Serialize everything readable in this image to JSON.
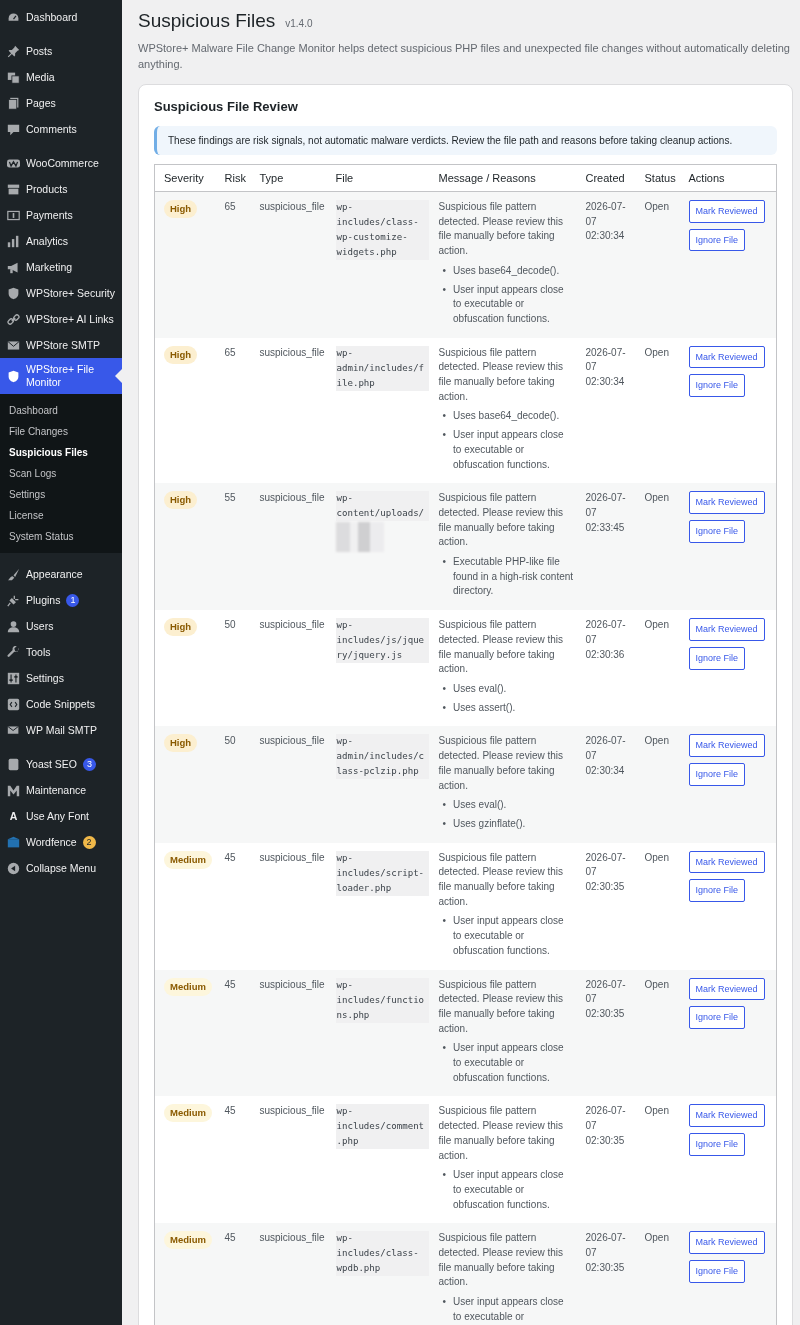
{
  "sidebar": {
    "groups": [
      {
        "items": [
          {
            "label": "Dashboard",
            "selected": false
          }
        ]
      },
      {
        "items": [
          {
            "label": "Posts",
            "selected": false
          },
          {
            "label": "Media",
            "selected": false
          },
          {
            "label": "Pages",
            "selected": false
          },
          {
            "label": "Comments",
            "selected": false
          }
        ]
      },
      {
        "items": [
          {
            "label": "WooCommerce",
            "selected": false
          },
          {
            "label": "Products",
            "selected": false
          },
          {
            "label": "Payments",
            "selected": false
          },
          {
            "label": "Analytics",
            "selected": false
          },
          {
            "label": "Marketing",
            "selected": false
          },
          {
            "label": "WPStore+ Security",
            "selected": false
          },
          {
            "label": "WPStore+ AI Links",
            "selected": false
          },
          {
            "label": "WPStore SMTP",
            "selected": false
          },
          {
            "label": "WPStore+ File Monitor",
            "selected": true,
            "submenu": [
              {
                "label": "Dashboard",
                "selected": false
              },
              {
                "label": "File Changes",
                "selected": false
              },
              {
                "label": "Suspicious Files",
                "selected": true
              },
              {
                "label": "Scan Logs",
                "selected": false
              },
              {
                "label": "Settings",
                "selected": false
              },
              {
                "label": "License",
                "selected": false
              },
              {
                "label": "System Status",
                "selected": false
              }
            ]
          }
        ]
      },
      {
        "items": [
          {
            "label": "Appearance",
            "selected": false
          },
          {
            "label": "Plugins",
            "selected": false,
            "badge": {
              "text": "1",
              "color": "#3858e9"
            }
          },
          {
            "label": "Users",
            "selected": false
          },
          {
            "label": "Tools",
            "selected": false
          },
          {
            "label": "Settings",
            "selected": false
          },
          {
            "label": "Code Snippets",
            "selected": false
          },
          {
            "label": "WP Mail SMTP",
            "selected": false
          }
        ]
      },
      {
        "items": [
          {
            "label": "Yoast SEO",
            "selected": false,
            "badge": {
              "text": "3",
              "color": "#3858e9"
            }
          },
          {
            "label": "Maintenance",
            "selected": false
          },
          {
            "label": "Use Any Font",
            "selected": false,
            "icon_glyph": "A"
          },
          {
            "label": "Wordfence",
            "selected": false,
            "badge": {
              "text": "2",
              "color": "#f0b849"
            }
          },
          {
            "label": "Collapse Menu",
            "selected": false
          }
        ]
      }
    ]
  },
  "page": {
    "title": "Suspicious Files",
    "version": "v1.4.0",
    "description": "WPStore+ Malware File Change Monitor helps detect suspicious PHP files and unexpected file changes without automatically deleting anything."
  },
  "card": {
    "title": "Suspicious File Review",
    "notice": "These findings are risk signals, not automatic malware verdicts. Review the file path and reasons before taking cleanup actions."
  },
  "table": {
    "columns": [
      "Severity",
      "Risk",
      "Type",
      "File",
      "Message / Reasons",
      "Created",
      "Status",
      "Actions"
    ],
    "rows": [
      {
        "severity": {
          "label": "High",
          "color": "#fcefd0"
        },
        "risk": "65",
        "type": "suspicious_file",
        "file": "wp-includes/class-wp-customize-widgets.php",
        "message": "Suspicious file pattern detected. Please review this file manually before taking action.",
        "reasons": [
          {
            "marker": "•",
            "text": "Uses base64_decode()."
          },
          {
            "marker": "•",
            "text": "User input appears close to executable or obfuscation functions."
          }
        ],
        "created": "2026-07-07 02:30:34",
        "status": "Open",
        "actions": [
          "Mark Reviewed",
          "Ignore File"
        ]
      },
      {
        "severity": {
          "label": "High",
          "color": "#fcefd0"
        },
        "risk": "65",
        "type": "suspicious_file",
        "file": "wp-admin/includes/file.php",
        "message": "Suspicious file pattern detected. Please review this file manually before taking action.",
        "reasons": [
          {
            "marker": "•",
            "text": "Uses base64_decode()."
          },
          {
            "marker": "•",
            "text": "User input appears close to executable or obfuscation functions."
          }
        ],
        "created": "2026-07-07 02:30:34",
        "status": "Open",
        "actions": [
          "Mark Reviewed",
          "Ignore File"
        ]
      },
      {
        "severity": {
          "label": "High",
          "color": "#fcefd0"
        },
        "risk": "55",
        "type": "suspicious_file",
        "file": "wp-content/uploads/",
        "file_redacted": true,
        "message": "Suspicious file pattern detected. Please review this file manually before taking action.",
        "reasons": [
          {
            "marker": "•",
            "text": "Executable PHP-like file found in a high-risk content directory."
          }
        ],
        "created": "2026-07-07 02:33:45",
        "status": "Open",
        "actions": [
          "Mark Reviewed",
          "Ignore File"
        ]
      },
      {
        "severity": {
          "label": "High",
          "color": "#fcefd0"
        },
        "risk": "50",
        "type": "suspicious_file",
        "file": "wp-includes/js/jquery/jquery.js",
        "message": "Suspicious file pattern detected. Please review this file manually before taking action.",
        "reasons": [
          {
            "marker": "•",
            "text": "Uses eval()."
          },
          {
            "marker": "•",
            "text": "Uses assert()."
          }
        ],
        "created": "2026-07-07 02:30:36",
        "status": "Open",
        "actions": [
          "Mark Reviewed",
          "Ignore File"
        ]
      },
      {
        "severity": {
          "label": "High",
          "color": "#fcefd0"
        },
        "risk": "50",
        "type": "suspicious_file",
        "file": "wp-admin/includes/class-pclzip.php",
        "message": "Suspicious file pattern detected. Please review this file manually before taking action.",
        "reasons": [
          {
            "marker": "•",
            "text": "Uses eval()."
          },
          {
            "marker": "•",
            "text": "Uses gzinflate()."
          }
        ],
        "created": "2026-07-07 02:30:34",
        "status": "Open",
        "actions": [
          "Mark Reviewed",
          "Ignore File"
        ]
      },
      {
        "severity": {
          "label": "Medium",
          "color": "#fdf6dc"
        },
        "risk": "45",
        "type": "suspicious_file",
        "file": "wp-includes/script-loader.php",
        "message": "Suspicious file pattern detected. Please review this file manually before taking action.",
        "reasons": [
          {
            "marker": "•",
            "text": "User input appears close to executable or obfuscation functions."
          }
        ],
        "created": "2026-07-07 02:30:35",
        "status": "Open",
        "actions": [
          "Mark Reviewed",
          "Ignore File"
        ]
      },
      {
        "severity": {
          "label": "Medium",
          "color": "#fdf6dc"
        },
        "risk": "45",
        "type": "suspicious_file",
        "file": "wp-includes/functions.php",
        "message": "Suspicious file pattern detected. Please review this file manually before taking action.",
        "reasons": [
          {
            "marker": "•",
            "text": "User input appears close to executable or obfuscation functions."
          }
        ],
        "created": "2026-07-07 02:30:35",
        "status": "Open",
        "actions": [
          "Mark Reviewed",
          "Ignore File"
        ]
      },
      {
        "severity": {
          "label": "Medium",
          "color": "#fdf6dc"
        },
        "risk": "45",
        "type": "suspicious_file",
        "file": "wp-includes/comment.php",
        "message": "Suspicious file pattern detected. Please review this file manually before taking action.",
        "reasons": [
          {
            "marker": "•",
            "text": "User input appears close to executable or obfuscation functions."
          }
        ],
        "created": "2026-07-07 02:30:35",
        "status": "Open",
        "actions": [
          "Mark Reviewed",
          "Ignore File"
        ]
      },
      {
        "severity": {
          "label": "Medium",
          "color": "#fdf6dc"
        },
        "risk": "45",
        "type": "suspicious_file",
        "file": "wp-includes/class-wpdb.php",
        "message": "Suspicious file pattern detected. Please review this file manually before taking action.",
        "reasons": [
          {
            "marker": "•",
            "text": "User input appears close to executable or"
          }
        ],
        "created": "2026-07-07 02:30:35",
        "status": "Open",
        "actions": [
          "Mark Reviewed",
          "Ignore File"
        ]
      }
    ]
  }
}
